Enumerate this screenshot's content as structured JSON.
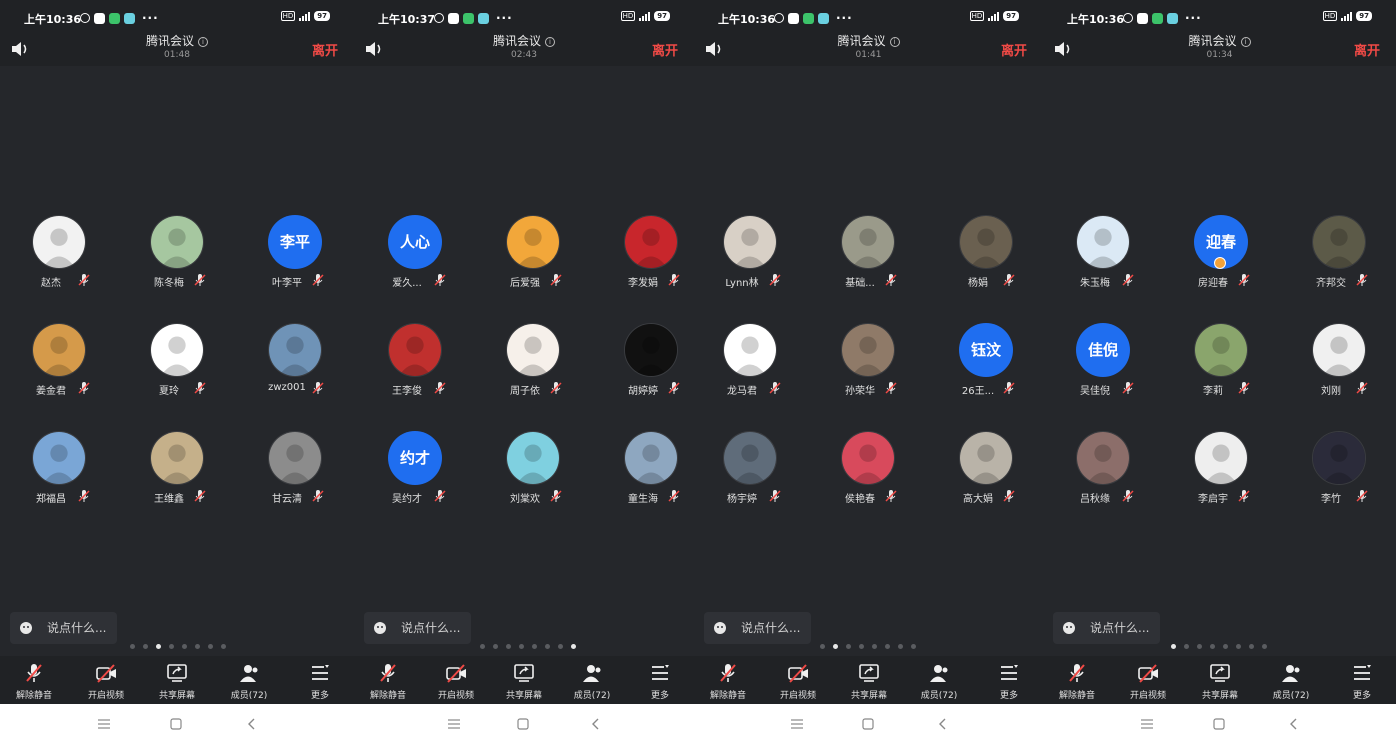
{
  "status": {
    "time_values": [
      "上午10:36",
      "上午10:37",
      "上午10:36",
      "上午10:36"
    ],
    "more_dots": "···",
    "network": "HD",
    "battery": "97"
  },
  "meeting": {
    "title": "腾讯会议",
    "timers": [
      "01:48",
      "02:43",
      "01:41",
      "01:34"
    ],
    "leave_label": "离开"
  },
  "chat": {
    "placeholder": "说点什么..."
  },
  "toolbar": {
    "unmute": "解除静音",
    "start_video": "开启视频",
    "share_screen": "共享屏幕",
    "members": "成员(72)",
    "more": "更多"
  },
  "pager_active": [
    3,
    8,
    2,
    1
  ],
  "pager_count": 8,
  "screens": [
    {
      "participants": [
        {
          "name": "赵杰",
          "avatar": "photo",
          "color": "#f2f2f2"
        },
        {
          "name": "陈冬梅",
          "avatar": "photo",
          "color": "#a6c7a0"
        },
        {
          "name": "叶李平",
          "avatar": "text",
          "text": "李平"
        },
        {
          "name": "姜金君",
          "avatar": "photo",
          "color": "#d59a4a"
        },
        {
          "name": "夏玲",
          "avatar": "photo",
          "color": "#ffffff"
        },
        {
          "name": "zwz001",
          "avatar": "photo",
          "color": "#6f93b7"
        },
        {
          "name": "郑福昌",
          "avatar": "photo",
          "color": "#7aa6d6"
        },
        {
          "name": "王维鑫",
          "avatar": "photo",
          "color": "#c5b08a"
        },
        {
          "name": "甘云清",
          "avatar": "photo",
          "color": "#8c8c8c"
        }
      ]
    },
    {
      "participants": [
        {
          "name": "爱久...",
          "avatar": "text",
          "text": "人心"
        },
        {
          "name": "后爱强",
          "avatar": "photo",
          "color": "#f2a73a"
        },
        {
          "name": "李发娟",
          "avatar": "photo",
          "color": "#c8262c"
        },
        {
          "name": "王李俊",
          "avatar": "photo",
          "color": "#c0302e"
        },
        {
          "name": "周子依",
          "avatar": "photo",
          "color": "#f6f0ea"
        },
        {
          "name": "胡婷婷",
          "avatar": "photo",
          "color": "#111111"
        },
        {
          "name": "吴约才",
          "avatar": "text",
          "text": "约才"
        },
        {
          "name": "刘棠欢",
          "avatar": "photo",
          "color": "#7fd0e0"
        },
        {
          "name": "童生海",
          "avatar": "photo",
          "color": "#8ea7c0"
        }
      ]
    },
    {
      "participants": [
        {
          "name": "Lynn林",
          "avatar": "photo",
          "color": "#d8d0c6"
        },
        {
          "name": "基础...",
          "avatar": "photo",
          "color": "#9a9a8a"
        },
        {
          "name": "杨娟",
          "avatar": "photo",
          "color": "#6a6050"
        },
        {
          "name": "龙马君",
          "avatar": "photo",
          "color": "#ffffff"
        },
        {
          "name": "孙荣华",
          "avatar": "photo",
          "color": "#8f7a68"
        },
        {
          "name": "26王...",
          "avatar": "text",
          "text": "钰汶"
        },
        {
          "name": "杨宇婷",
          "avatar": "photo",
          "color": "#5f6c7a"
        },
        {
          "name": "侯艳春",
          "avatar": "photo",
          "color": "#d84a5c"
        },
        {
          "name": "高大娟",
          "avatar": "photo",
          "color": "#b9b3a8"
        }
      ]
    },
    {
      "participants": [
        {
          "name": "朱玉梅",
          "avatar": "photo",
          "color": "#dbe9f5"
        },
        {
          "name": "房迎春",
          "avatar": "text",
          "text": "迎春",
          "tag": true
        },
        {
          "name": "齐邦交",
          "avatar": "photo",
          "color": "#5c5a48"
        },
        {
          "name": "吴佳倪",
          "avatar": "text",
          "text": "佳倪"
        },
        {
          "name": "李莉",
          "avatar": "photo",
          "color": "#8aa56c"
        },
        {
          "name": "刘刚",
          "avatar": "photo",
          "color": "#f0f0f0"
        },
        {
          "name": "吕秋缘",
          "avatar": "photo",
          "color": "#8c6e6a"
        },
        {
          "name": "李启宇",
          "avatar": "photo",
          "color": "#eeeeee"
        },
        {
          "name": "李竹",
          "avatar": "photo",
          "color": "#2b2b3a"
        }
      ]
    }
  ]
}
